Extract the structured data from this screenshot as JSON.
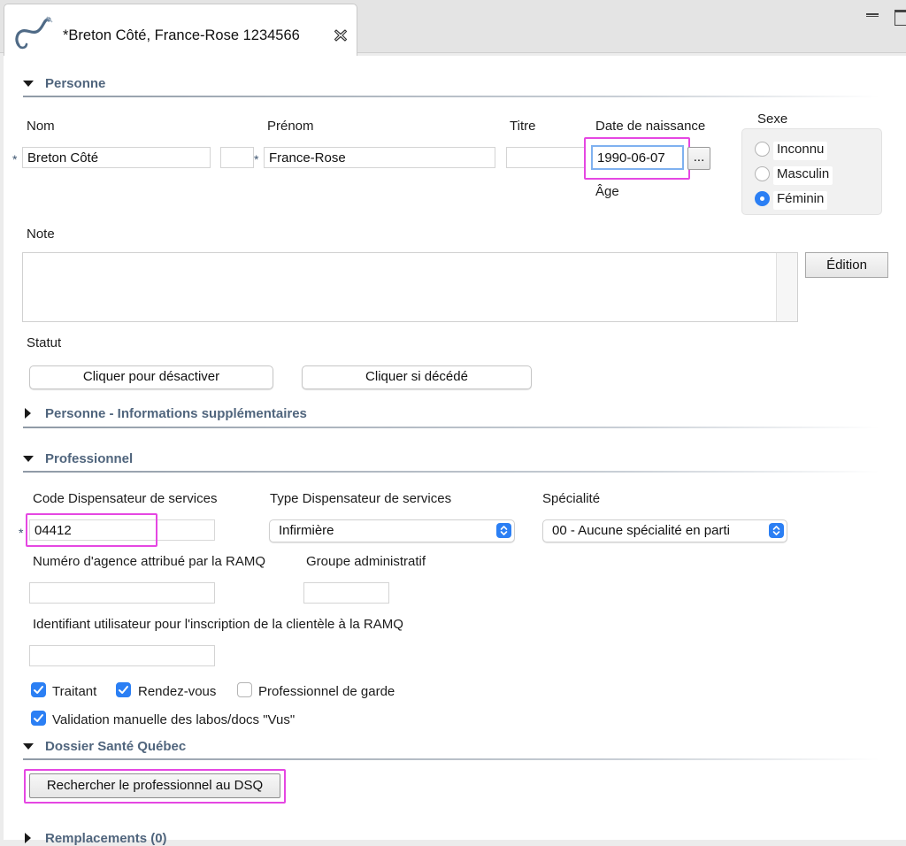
{
  "tab": {
    "title": "*Breton Côté, France-Rose 1234566",
    "icon": "stethoscope-icon"
  },
  "personne": {
    "section_title": "Personne",
    "nom_label": "Nom",
    "nom_value": "Breton Côté",
    "prenom_label": "Prénom",
    "prenom_value": "France-Rose",
    "titre_label": "Titre",
    "titre_value": "",
    "dob_label": "Date de naissance",
    "dob_value": "1990-06-07",
    "dob_button": "...",
    "age_label": "Âge",
    "sexe_label": "Sexe",
    "sexe_options": [
      "Inconnu",
      "Masculin",
      "Féminin"
    ],
    "sexe_selected": "Féminin",
    "note_label": "Note",
    "note_value": "",
    "edition_button": "Édition",
    "statut_label": "Statut",
    "desactiver_button": "Cliquer pour désactiver",
    "decede_button": "Cliquer si décédé",
    "required_marker": "*"
  },
  "personne_info": {
    "section_title": "Personne - Informations supplémentaires"
  },
  "professionnel": {
    "section_title": "Professionnel",
    "code_label": "Code Dispensateur de services",
    "code_value": "04412",
    "type_label": "Type Dispensateur de services",
    "type_value": "Infirmière",
    "specialite_label": "Spécialité",
    "specialite_value": "00 - Aucune spécialité en parti",
    "agence_label": "Numéro d'agence attribué par la RAMQ",
    "agence_value": "",
    "groupe_label": "Groupe administratif",
    "groupe_value": "",
    "identifiant_label": "Identifiant utilisateur pour l'inscription de la clientèle à la RAMQ",
    "identifiant_value": "",
    "checkboxes": [
      {
        "label": "Traitant",
        "checked": true
      },
      {
        "label": "Rendez-vous",
        "checked": true
      },
      {
        "label": "Professionnel de garde",
        "checked": false
      },
      {
        "label": "Validation manuelle des labos/docs \"Vus\"",
        "checked": true
      }
    ]
  },
  "dsq": {
    "section_title": "Dossier Santé Québec",
    "search_button": "Rechercher le professionnel au DSQ"
  },
  "remplacements": {
    "section_title": "Remplacements (0)"
  },
  "colors": {
    "accent": "#2b7ff4",
    "highlight": "#e547e2",
    "section_title": "#50657d"
  }
}
